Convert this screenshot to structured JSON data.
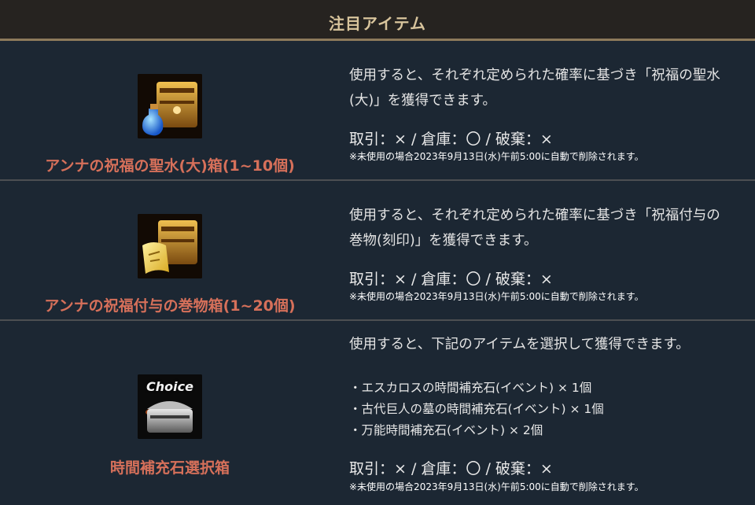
{
  "header": {
    "title": "注目アイテム"
  },
  "items": [
    {
      "name": "アンナの祝福の聖水(大)箱(1~10個)",
      "icon": "treasure-chest-potion-icon",
      "desc_line1": "使用すると、それぞれ定められた確率に基づき「祝福の聖水",
      "desc_line2": "(大)」を獲得できます。",
      "trade": "取引：× / 倉庫：〇 / 破棄：×",
      "note": "※未使用の場合2023年9月13日(水)午前5:00に自動で削除されます。"
    },
    {
      "name": "アンナの祝福付与の巻物箱(1~20個)",
      "icon": "treasure-chest-scroll-icon",
      "desc_line1": "使用すると、それぞれ定められた確率に基づき「祝福付与の",
      "desc_line2": "巻物(刻印)」を獲得できます。",
      "trade": "取引：× / 倉庫：〇 / 破棄：×",
      "note": "※未使用の場合2023年9月13日(水)午前5:00に自動で削除されます。"
    },
    {
      "name": "時間補充石選択箱",
      "icon": "choice-chest-icon",
      "icon_text": "Choice",
      "desc_line1": "使用すると、下記のアイテムを選択して獲得できます。",
      "bullets": [
        "・エスカロスの時間補充石(イベント) × 1個",
        "・古代巨人の墓の時間補充石(イベント) × 1個",
        "・万能時間補充石(イベント) × 2個"
      ],
      "trade": "取引：× / 倉庫：〇 / 破棄：×",
      "note": "※未使用の場合2023年9月13日(水)午前5:00に自動で削除されます。"
    }
  ],
  "colors": {
    "background": "#1c2733",
    "item_name": "#d6705a",
    "header_text": "#d8c49c",
    "header_border": "#8d7a5b"
  }
}
